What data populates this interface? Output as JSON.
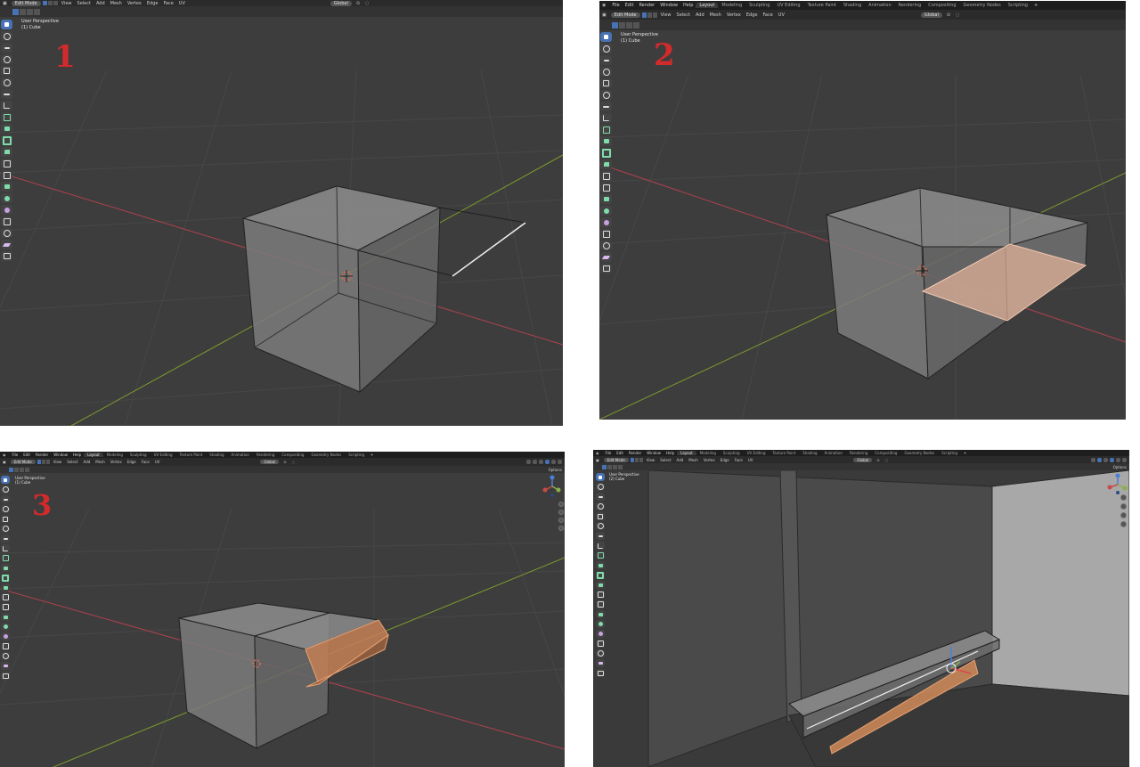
{
  "window": {
    "title": ""
  },
  "panels": [
    {
      "id": 1,
      "step_label": "1",
      "menu": [],
      "workspace_tabs": [],
      "header": {
        "mode": "Edit Mode",
        "menus": [
          "View",
          "Select",
          "Add",
          "Mesh",
          "Vertex",
          "Edge",
          "Face",
          "UV"
        ],
        "transform": "Global"
      },
      "overlay": {
        "view": "User Perspective",
        "object": "(1) Cube"
      }
    },
    {
      "id": 2,
      "step_label": "2",
      "menu": [
        "File",
        "Edit",
        "Render",
        "Window",
        "Help"
      ],
      "workspace_tabs": [
        "Layout",
        "Modeling",
        "Sculpting",
        "UV Editing",
        "Texture Paint",
        "Shading",
        "Animation",
        "Rendering",
        "Compositing",
        "Geometry Nodes",
        "Scripting"
      ],
      "active_tab": "Layout",
      "header": {
        "mode": "Edit Mode",
        "menus": [
          "View",
          "Select",
          "Add",
          "Mesh",
          "Vertex",
          "Edge",
          "Face",
          "UV"
        ],
        "transform": "Global"
      },
      "overlay": {
        "view": "User Perspective",
        "object": "(1) Cube"
      }
    },
    {
      "id": 3,
      "step_label": "3",
      "menu": [
        "File",
        "Edit",
        "Render",
        "Window",
        "Help"
      ],
      "workspace_tabs": [
        "Layout",
        "Modeling",
        "Sculpting",
        "UV Editing",
        "Texture Paint",
        "Shading",
        "Animation",
        "Rendering",
        "Compositing",
        "Geometry Nodes",
        "Scripting"
      ],
      "active_tab": "Layout",
      "header": {
        "mode": "Edit Mode",
        "menus": [
          "View",
          "Select",
          "Add",
          "Mesh",
          "Vertex",
          "Edge",
          "Face",
          "UV"
        ],
        "transform": "Global",
        "options": "Options"
      },
      "overlay": {
        "view": "User Perspective",
        "object": "(1) Cube"
      }
    },
    {
      "id": 4,
      "step_label": "",
      "menu": [
        "File",
        "Edit",
        "Render",
        "Window",
        "Help"
      ],
      "workspace_tabs": [
        "Layout",
        "Modeling",
        "Sculpting",
        "UV Editing",
        "Texture Paint",
        "Shading",
        "Animation",
        "Rendering",
        "Compositing",
        "Geometry Nodes",
        "Scripting"
      ],
      "active_tab": "Layout",
      "header": {
        "mode": "Edit Mode",
        "menus": [
          "View",
          "Select",
          "Add",
          "Mesh",
          "Vertex",
          "Edge",
          "Face",
          "UV"
        ],
        "transform": "Global",
        "options": "Options"
      },
      "overlay": {
        "view": "User Perspective",
        "object": "(2) Cube"
      }
    }
  ],
  "colors": {
    "viewport_bg": "#3d3d3d",
    "grid": "#4a4a4a",
    "x_axis": "#b0414f",
    "y_axis": "#7a9a2e",
    "mesh_face": "#8a8a8a",
    "selection": "#e8946a",
    "active_tool": "#4772b3",
    "step_label": "#d22b2b"
  },
  "icons": [
    "blender-logo-icon",
    "select-box-icon",
    "cursor-icon",
    "move-icon",
    "rotate-icon",
    "scale-icon",
    "transform-icon",
    "annotate-icon",
    "measure-icon",
    "add-cube-icon",
    "extrude-icon",
    "inset-icon",
    "bevel-icon",
    "loop-cut-icon",
    "knife-icon",
    "poly-build-icon",
    "spin-icon",
    "smooth-icon",
    "edge-slide-icon",
    "shrink-fatten-icon",
    "shear-icon",
    "rip-icon",
    "orientation-gizmo-icon",
    "zoom-icon",
    "hand-pan-icon",
    "camera-icon",
    "grid-view-icon"
  ]
}
